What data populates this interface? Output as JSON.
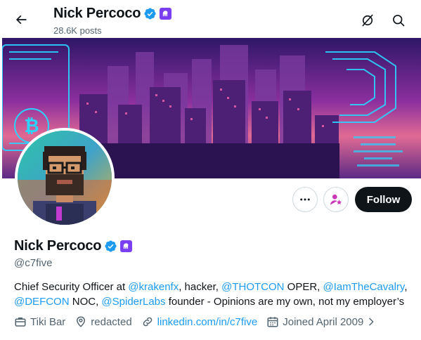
{
  "header": {
    "title": "Nick Percoco",
    "posts_count": "28.6K posts"
  },
  "profile": {
    "display_name": "Nick Percoco",
    "handle": "@c7five",
    "bio": {
      "t1": "Chief Security Officer at ",
      "m1": "@krakenfx",
      "t2": ", hacker, ",
      "m2": "@THOTCON",
      "t3": " OPER, ",
      "m3": "@IamTheCavalry",
      "t4": ", ",
      "m4": "@DEFCON",
      "t5": " NOC, ",
      "m5": "@SpiderLabs",
      "t6": " founder - Opinions are my own, not my employer’s"
    },
    "meta": {
      "work": "Tiki Bar",
      "location": "redacted",
      "website": "linkedin.com/in/c7five",
      "joined": "Joined April 2009"
    }
  },
  "actions": {
    "follow_label": "Follow"
  },
  "colors": {
    "accent": "#1d9bf0",
    "follow_bg": "#0f1419",
    "kraken_badge": "#7b3ff2",
    "verified": "#1d9bf0"
  },
  "icons": {
    "back": "arrow-left-icon",
    "grok": "grok-icon",
    "search": "search-icon",
    "more": "more-icon",
    "subscribe": "subscribe-icon",
    "work": "briefcase-icon",
    "location": "location-pin-icon",
    "website": "link-icon",
    "joined": "calendar-icon"
  }
}
